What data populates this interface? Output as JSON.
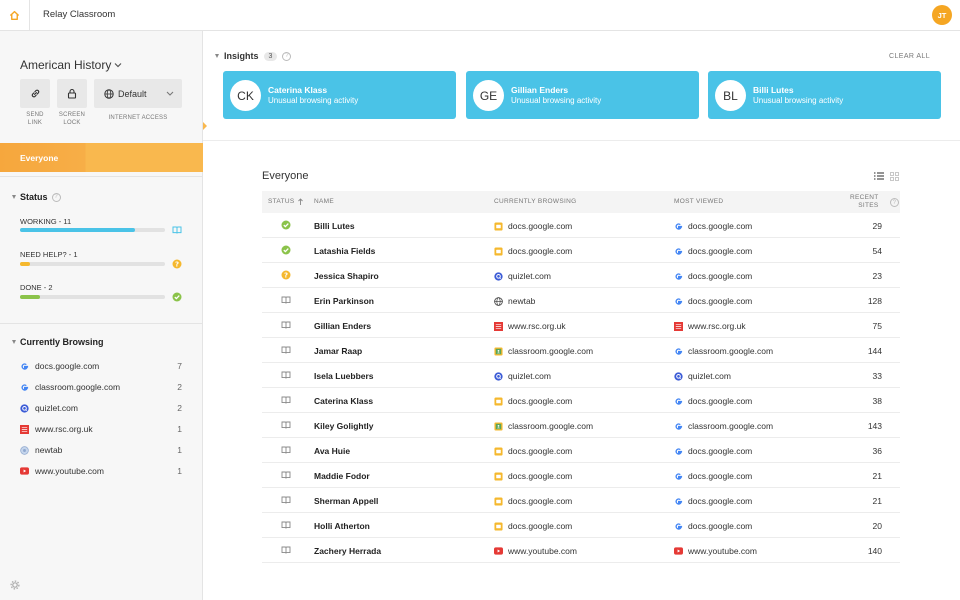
{
  "app": {
    "title": "Relay Classroom",
    "user_initials": "JT"
  },
  "sidebar": {
    "class_name": "American History",
    "tools": {
      "send_link": "SEND\nLINK",
      "screen_lock": "SCREEN\nLOCK",
      "internet_access_value": "Default",
      "internet_access_label": "INTERNET ACCESS"
    },
    "group": "Everyone",
    "status_heading": "Status",
    "statuses": [
      {
        "label": "WORKING - 11",
        "fraction": 0.79,
        "color": "#4ac3e7",
        "icon": "book-icon"
      },
      {
        "label": "NEED HELP? - 1",
        "fraction": 0.07,
        "color": "#f5b82e",
        "icon": "help-icon"
      },
      {
        "label": "DONE - 2",
        "fraction": 0.14,
        "color": "#8bc34a",
        "icon": "check-icon"
      }
    ],
    "browsing_heading": "Currently Browsing",
    "browsing": [
      {
        "site": "docs.google.com",
        "count": "7",
        "icon": "google-icon"
      },
      {
        "site": "classroom.google.com",
        "count": "2",
        "icon": "google-icon"
      },
      {
        "site": "quizlet.com",
        "count": "2",
        "icon": "quizlet-icon"
      },
      {
        "site": "www.rsc.org.uk",
        "count": "1",
        "icon": "rsc-icon"
      },
      {
        "site": "newtab",
        "count": "1",
        "icon": "globe-icon"
      },
      {
        "site": "www.youtube.com",
        "count": "1",
        "icon": "youtube-icon"
      }
    ]
  },
  "insights": {
    "title": "Insights",
    "count": "3",
    "clear_all": "CLEAR ALL",
    "cards": [
      {
        "initials": "CK",
        "name": "Caterina Klass",
        "desc": "Unusual browsing activity"
      },
      {
        "initials": "GE",
        "name": "Gillian Enders",
        "desc": "Unusual browsing activity"
      },
      {
        "initials": "BL",
        "name": "Billi Lutes",
        "desc": "Unusual browsing activity"
      }
    ]
  },
  "table": {
    "title": "Everyone",
    "headers": {
      "status": "STATUS",
      "name": "NAME",
      "browsing": "CURRENTLY BROWSING",
      "most_viewed": "MOST VIEWED",
      "recent": "RECENT\nSITES"
    },
    "rows": [
      {
        "status": "done",
        "name": "Billi Lutes",
        "browsing": "docs.google.com",
        "browsing_icon": "docs",
        "most": "docs.google.com",
        "most_icon": "google",
        "recent": "29"
      },
      {
        "status": "done",
        "name": "Latashia Fields",
        "browsing": "docs.google.com",
        "browsing_icon": "docs",
        "most": "docs.google.com",
        "most_icon": "google",
        "recent": "54"
      },
      {
        "status": "help",
        "name": "Jessica Shapiro",
        "browsing": "quizlet.com",
        "browsing_icon": "quizlet",
        "most": "docs.google.com",
        "most_icon": "google",
        "recent": "23"
      },
      {
        "status": "working",
        "name": "Erin Parkinson",
        "browsing": "newtab",
        "browsing_icon": "globe",
        "most": "docs.google.com",
        "most_icon": "google",
        "recent": "128"
      },
      {
        "status": "working",
        "name": "Gillian Enders",
        "browsing": "www.rsc.org.uk",
        "browsing_icon": "rsc",
        "most": "www.rsc.org.uk",
        "most_icon": "rsc",
        "recent": "75"
      },
      {
        "status": "working",
        "name": "Jamar Raap",
        "browsing": "classroom.google.com",
        "browsing_icon": "classroom",
        "most": "classroom.google.com",
        "most_icon": "google",
        "recent": "144"
      },
      {
        "status": "working",
        "name": "Isela Luebbers",
        "browsing": "quizlet.com",
        "browsing_icon": "quizlet",
        "most": "quizlet.com",
        "most_icon": "quizlet",
        "recent": "33"
      },
      {
        "status": "working",
        "name": "Caterina Klass",
        "browsing": "docs.google.com",
        "browsing_icon": "docs",
        "most": "docs.google.com",
        "most_icon": "google",
        "recent": "38"
      },
      {
        "status": "working",
        "name": "Kiley Golightly",
        "browsing": "classroom.google.com",
        "browsing_icon": "classroom",
        "most": "classroom.google.com",
        "most_icon": "google",
        "recent": "143"
      },
      {
        "status": "working",
        "name": "Ava Huie",
        "browsing": "docs.google.com",
        "browsing_icon": "docs",
        "most": "docs.google.com",
        "most_icon": "google",
        "recent": "36"
      },
      {
        "status": "working",
        "name": "Maddie Fodor",
        "browsing": "docs.google.com",
        "browsing_icon": "docs",
        "most": "docs.google.com",
        "most_icon": "google",
        "recent": "21"
      },
      {
        "status": "working",
        "name": "Sherman Appell",
        "browsing": "docs.google.com",
        "browsing_icon": "docs",
        "most": "docs.google.com",
        "most_icon": "google",
        "recent": "21"
      },
      {
        "status": "working",
        "name": "Holli Atherton",
        "browsing": "docs.google.com",
        "browsing_icon": "docs",
        "most": "docs.google.com",
        "most_icon": "google",
        "recent": "20"
      },
      {
        "status": "working",
        "name": "Zachery Herrada",
        "browsing": "www.youtube.com",
        "browsing_icon": "youtube",
        "most": "www.youtube.com",
        "most_icon": "youtube",
        "recent": "140"
      }
    ]
  }
}
